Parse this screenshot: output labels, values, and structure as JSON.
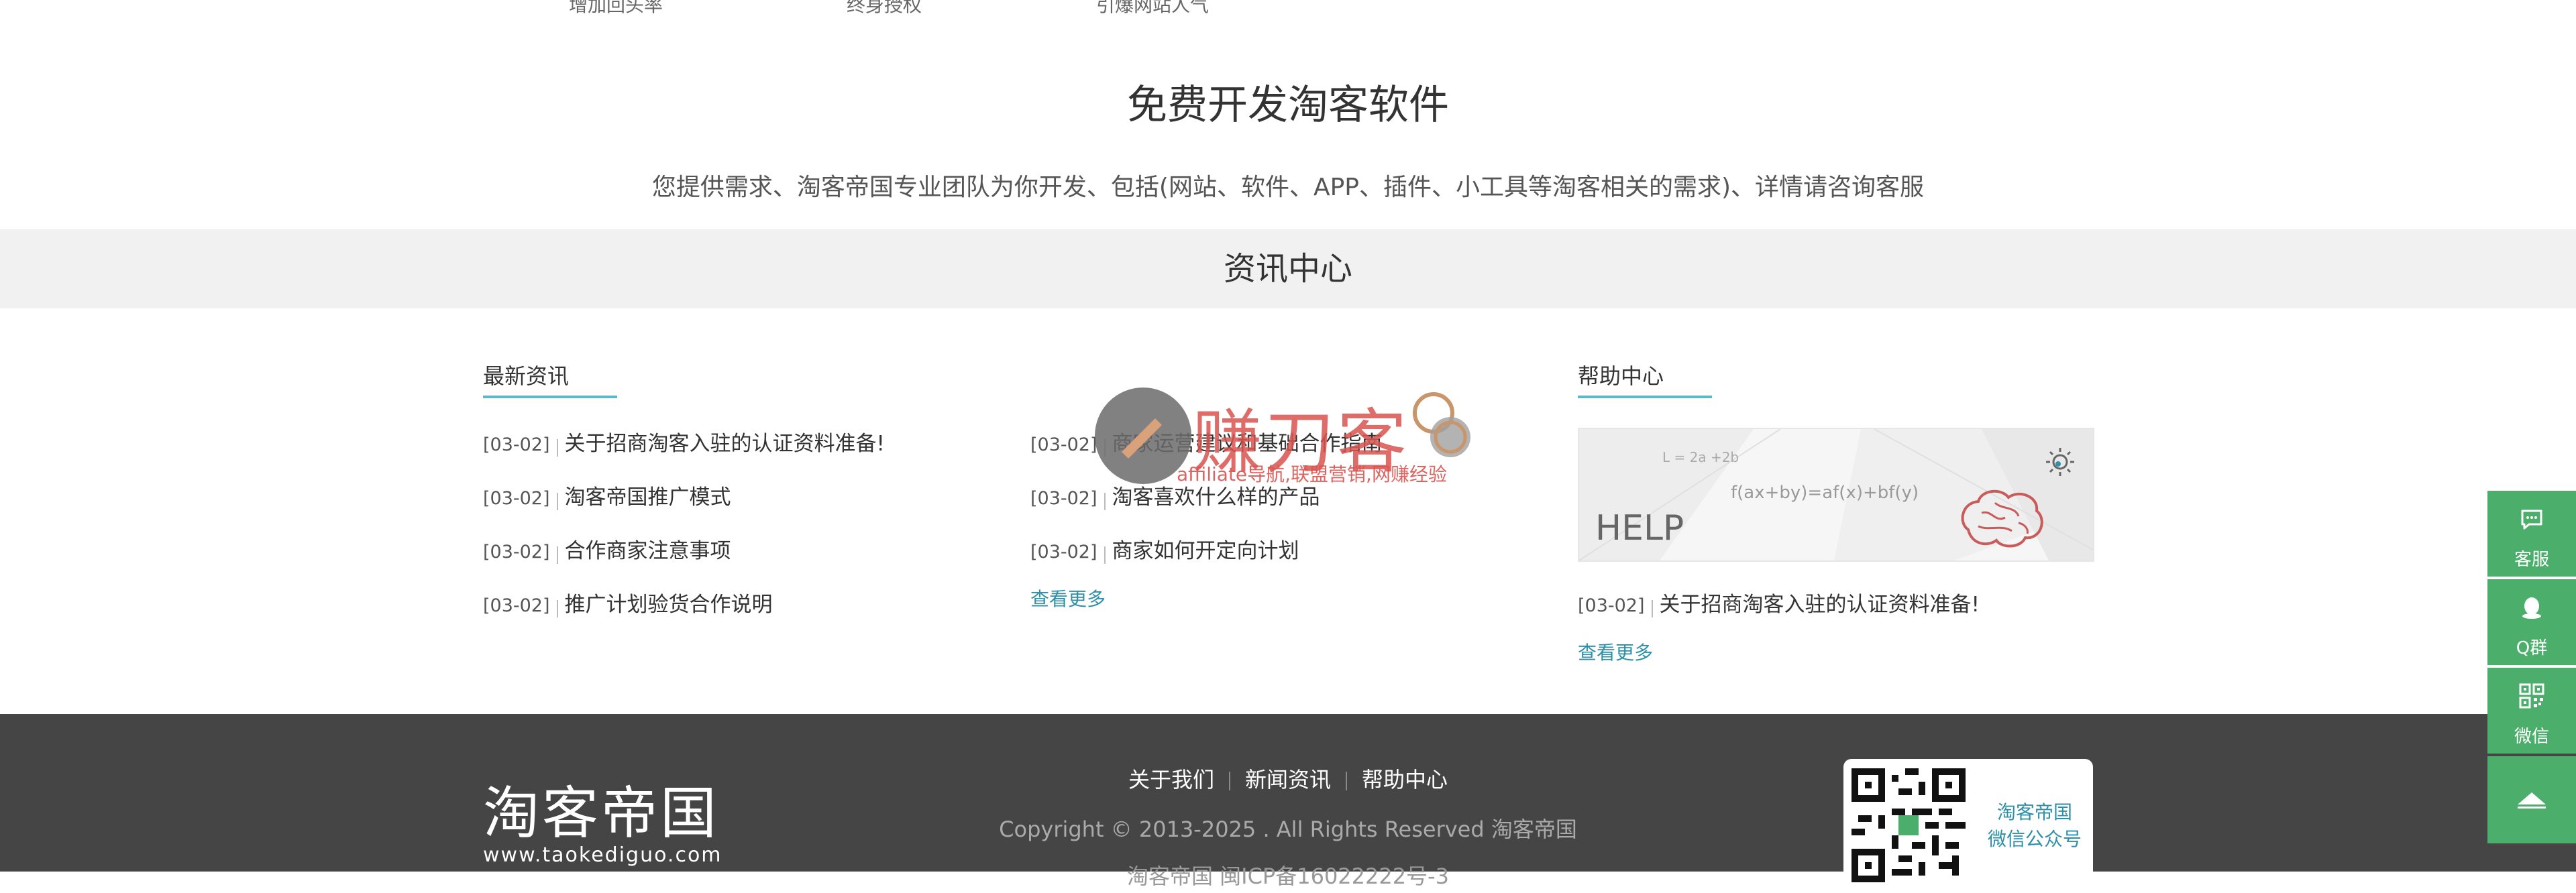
{
  "features_top": [
    "增加回头率",
    "终身授权",
    "引爆网站人气"
  ],
  "dev": {
    "title": "免费开发淘客软件",
    "description": "您提供需求、淘客帝国专业团队为你开发、包括(网站、软件、APP、插件、小工具等淘客相关的需求)、详情请咨询客服"
  },
  "news_center": {
    "title": "资讯中心"
  },
  "latest_news": {
    "heading": "最新资讯",
    "items": [
      {
        "date": "[03-02]",
        "title": "关于招商淘客入驻的认证资料准备!"
      },
      {
        "date": "[03-02]",
        "title": "淘客帝国推广模式"
      },
      {
        "date": "[03-02]",
        "title": "合作商家注意事项"
      },
      {
        "date": "[03-02]",
        "title": "推广计划验货合作说明"
      }
    ]
  },
  "middle_news": {
    "items": [
      {
        "date": "[03-02]",
        "title": "商家运营建议和基础合作指南"
      },
      {
        "date": "[03-02]",
        "title": "淘客喜欢什么样的产品"
      },
      {
        "date": "[03-02]",
        "title": "商家如何开定向计划"
      }
    ],
    "more": "查看更多"
  },
  "help_center": {
    "heading": "帮助中心",
    "image": {
      "formula1": "L = 2a +2b",
      "formula2": "f(ax+by)=af(x)+bf(y)",
      "label": "HELP"
    },
    "items": [
      {
        "date": "[03-02]",
        "title": "关于招商淘客入驻的认证资料准备!"
      }
    ],
    "more": "查看更多"
  },
  "watermark": {
    "brand": "赚刀客",
    "sub": "affiliate导航,联盟营销,网赚经验"
  },
  "footer": {
    "logo_cn": "淘客帝国",
    "logo_url": "www.taokediguo.com",
    "nav": [
      "关于我们",
      "新闻资讯",
      "帮助中心"
    ],
    "copyright": "Copyright © 2013-2025 . All Rights Reserved 淘客帝国",
    "icp": "淘客帝国 闽ICP备16022222号-3",
    "qr_caption_line1": "淘客帝国",
    "qr_caption_line2": "微信公众号"
  },
  "sidebar": {
    "service": "客服",
    "qq_group": "Q群",
    "wechat": "微信"
  },
  "colors": {
    "accent": "#5bb8c4",
    "link": "#2e8fa8",
    "sidebar": "#4cae6b",
    "footer_bg": "#454545",
    "band_bg": "#f1f1f1"
  }
}
